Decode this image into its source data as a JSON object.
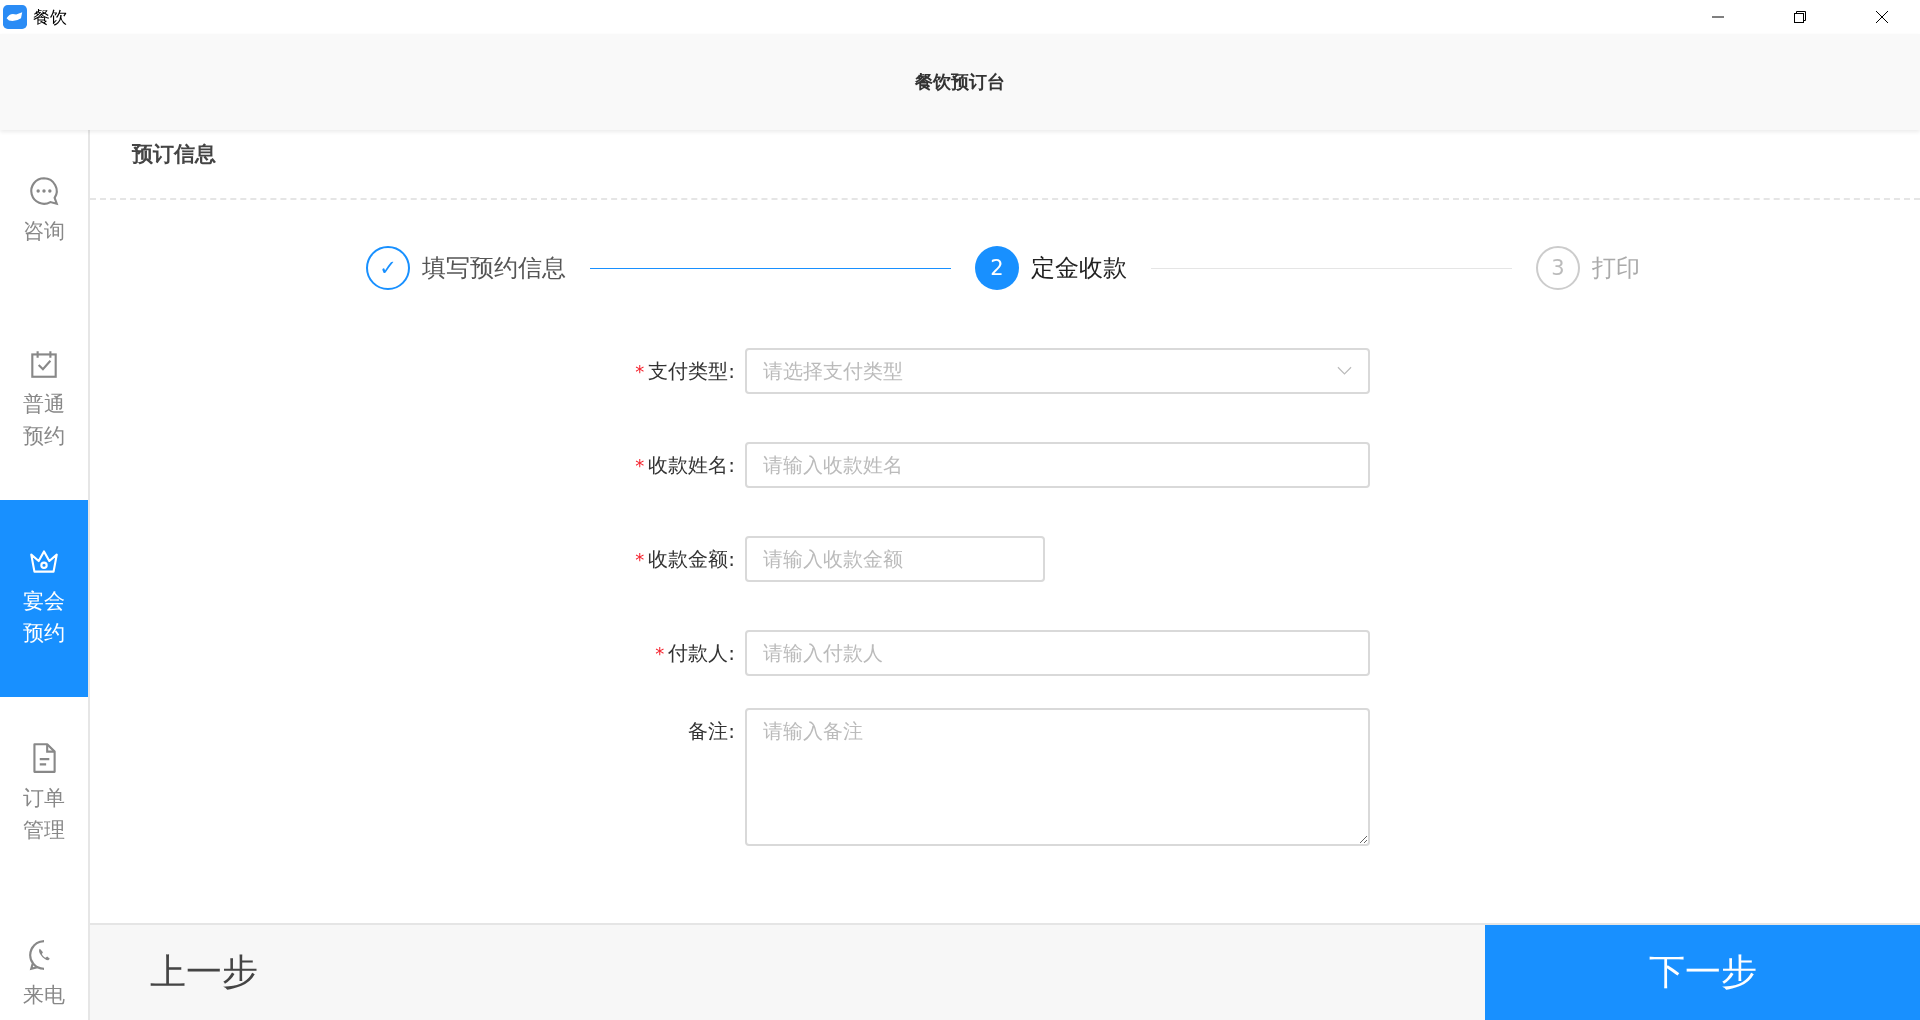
{
  "window": {
    "title": "餐饮"
  },
  "header": {
    "title": "餐饮预订台"
  },
  "sidebar": {
    "items": [
      {
        "label": "咨询",
        "selected": false
      },
      {
        "label": "普通预约",
        "selected": false
      },
      {
        "label": "宴会预约",
        "selected": true
      },
      {
        "label": "订单管理",
        "selected": false
      },
      {
        "label": "来电",
        "selected": false
      }
    ]
  },
  "section_title": "预订信息",
  "steps": [
    {
      "marker": "✓",
      "label": "填写预约信息",
      "done": true,
      "selected": false
    },
    {
      "marker": "2",
      "label": "定金收款",
      "done": false,
      "selected": true
    },
    {
      "marker": "3",
      "label": "打印",
      "done": false,
      "selected": false
    }
  ],
  "form": {
    "fields": [
      {
        "required_mark": "*",
        "label": "支付类型:",
        "placeholder": "请选择支付类型",
        "kind": "select",
        "short": false
      },
      {
        "required_mark": "*",
        "label": "收款姓名:",
        "placeholder": "请输入收款姓名",
        "kind": "input",
        "short": false
      },
      {
        "required_mark": "*",
        "label": "收款金额:",
        "placeholder": "请输入收款金额",
        "kind": "input",
        "short": true
      },
      {
        "required_mark": "*",
        "label": "付款人:",
        "placeholder": "请输入付款人",
        "kind": "input",
        "short": false
      },
      {
        "label": "备注:",
        "placeholder": "请输入备注",
        "kind": "textarea",
        "short": false
      }
    ]
  },
  "footer": {
    "back": "上一步",
    "next": "下一步"
  }
}
